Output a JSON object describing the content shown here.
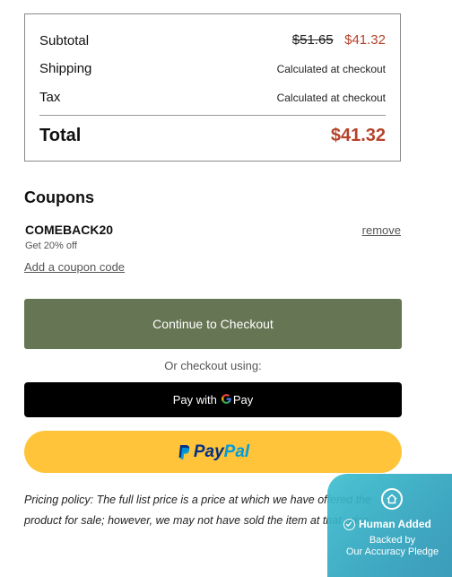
{
  "summary": {
    "subtotal_label": "Subtotal",
    "subtotal_original": "$51.65",
    "subtotal_discounted": "$41.32",
    "shipping_label": "Shipping",
    "shipping_value": "Calculated at checkout",
    "tax_label": "Tax",
    "tax_value": "Calculated at checkout",
    "total_label": "Total",
    "total_value": "$41.32"
  },
  "coupons": {
    "heading": "Coupons",
    "code": "COMEBACK20",
    "description": "Get 20% off",
    "remove_label": "remove",
    "add_label": "Add a coupon code"
  },
  "checkout": {
    "button_label": "Continue to Checkout",
    "alt_label": "Or checkout using:",
    "gpay_prefix": "Pay with",
    "gpay_g": "G",
    "gpay_suffix": "Pay",
    "paypal_part1": "Pay",
    "paypal_part2": "Pal"
  },
  "policy": {
    "text": "Pricing policy: The full list price is a price at which we have offered the product for sale; however, we may not have sold the item at that price."
  },
  "badge": {
    "title": "Human Added",
    "line1": "Backed by",
    "line2": "Our Accuracy Pledge"
  },
  "colors": {
    "accent_price": "#b5432a",
    "checkout_button": "#667553",
    "paypal_yellow": "#ffc439",
    "badge_teal": "#3dbfcf"
  },
  "icons": [
    "google-g-icon",
    "paypal-logo-icon",
    "house-icon",
    "checkmark-icon"
  ]
}
